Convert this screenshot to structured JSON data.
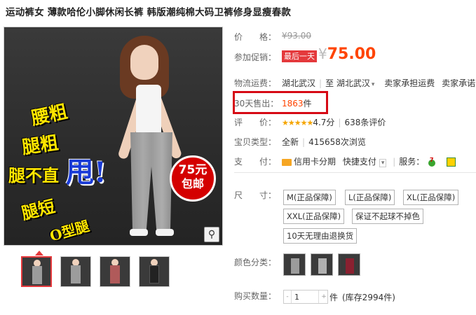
{
  "product": {
    "title": "运动裤女 薄款哈伦小脚休闲长裤 韩版潮纯棉大码卫裤修身显瘦春款"
  },
  "image": {
    "slogans": [
      "腰粗",
      "腿粗",
      "腿不直",
      "腿短",
      "O型腿"
    ],
    "shuai": "甩!",
    "badge_price": "75元",
    "badge_text": "包邮",
    "zoom_icon": "magnifier-icon"
  },
  "thumbnails": {
    "count": 4,
    "active_index": 0
  },
  "price_row": {
    "label": "价　　格：",
    "original": "¥93.00"
  },
  "promo_row": {
    "label": "参加促销：",
    "tag": "最后一天",
    "currency": "¥",
    "price": "75.00"
  },
  "shipping": {
    "label": "物流运费：",
    "from": "湖北武汉",
    "divider": "至",
    "to": "湖北武汉",
    "seller_pays_1": "卖家承担运费",
    "seller_pays_2": "卖家承诺"
  },
  "sales": {
    "label": "30天售出：",
    "count": "1863",
    "unit": "件"
  },
  "rating": {
    "label": "评　　价：",
    "stars": "★★★★★",
    "score": "4.7分",
    "reviews": "638条评价"
  },
  "baby_type": {
    "label": "宝贝类型：",
    "condition": "全新",
    "views": "415658次浏览"
  },
  "payment": {
    "label": "支　　付：",
    "credit_installment": "信用卡分期",
    "quick_pay": "快捷支付",
    "services_label": "服务："
  },
  "size": {
    "label": "尺　　寸：",
    "options": [
      "M(正品保障)",
      "L(正品保障)",
      "XL(正品保障)",
      "XXL(正品保障)",
      "保证不起球不掉色",
      "10天无理由退换货"
    ]
  },
  "color": {
    "label": "颜色分类：",
    "swatch_colors": [
      "#9c9c9c",
      "#b0b0b0",
      "#8a2030"
    ]
  },
  "quantity": {
    "label": "购买数量：",
    "value": "1",
    "unit": "件",
    "stock": "(库存2994件)"
  },
  "colors": {
    "accent": "#ff4400",
    "promo_red": "#e4393c",
    "highlight_box": "#d60a15"
  }
}
